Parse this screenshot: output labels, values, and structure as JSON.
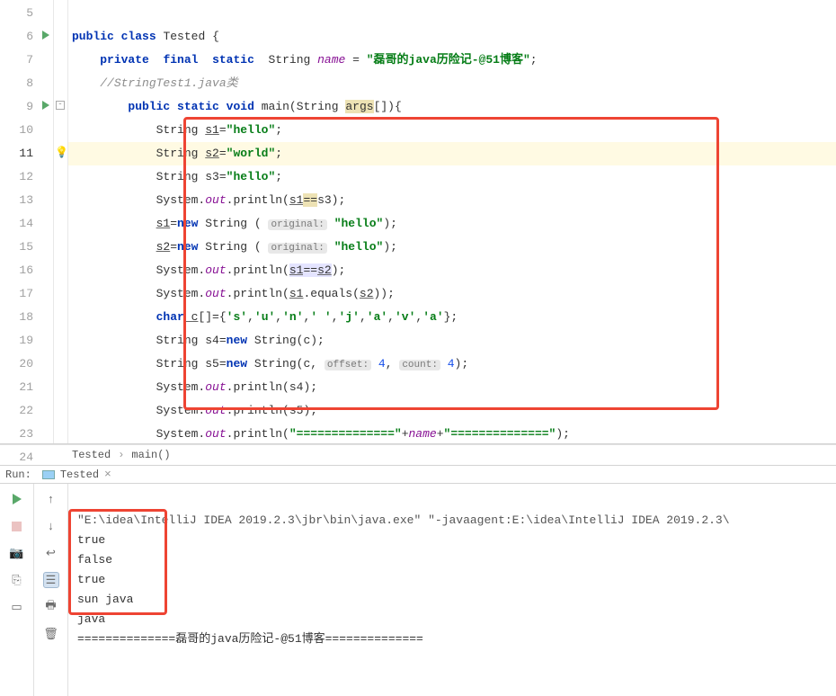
{
  "gutter": {
    "lines": [
      "5",
      "6",
      "7",
      "8",
      "9",
      "10",
      "11",
      "12",
      "13",
      "14",
      "15",
      "16",
      "17",
      "18",
      "19",
      "20",
      "21",
      "22",
      "23",
      "24"
    ]
  },
  "code": {
    "l6": {
      "public": "public",
      "class": "class",
      "name": "Tested"
    },
    "l7": {
      "private": "private",
      "final": "final",
      "static": "static",
      "type": "String",
      "field": "name",
      "eq": " = ",
      "str": "\"磊哥的java历险记-@51博客\""
    },
    "l8": {
      "comment": "//StringTest1.java类"
    },
    "l9": {
      "public": "public",
      "static": "static",
      "void": "void",
      "main": "main",
      "params": "(String ",
      "args": "args",
      "rest": "[]){"
    },
    "l10": {
      "type": "String ",
      "var": "s1",
      "eq": "=",
      "str": "\"hello\""
    },
    "l11": {
      "type": "String ",
      "var": "s2",
      "eq": "=",
      "str": "\"world\""
    },
    "l12": {
      "type": "String s3=",
      "str": "\"hello\""
    },
    "l13": {
      "sys": "System.",
      "out": "out",
      "print": ".println(",
      "s1": "s1",
      "op": "==",
      "rest": "s3);"
    },
    "l14": {
      "var": "s1",
      "eq": "=",
      "new": "new",
      "type": " String ( ",
      "hint": "original:",
      "str": " \"hello\"",
      "end": ");"
    },
    "l15": {
      "var": "s2",
      "eq": "=",
      "new": "new",
      "type": " String ( ",
      "hint": "original:",
      "str": " \"hello\"",
      "end": ");"
    },
    "l16": {
      "sys": "System.",
      "out": "out",
      "print": ".println(",
      "s1": "s1",
      "op": "==",
      "s2": "s2",
      "end": ");"
    },
    "l17": {
      "sys": "System.",
      "out": "out",
      "print": ".println(",
      "s1": "s1",
      "eq": ".equals(",
      "s2": "s2",
      "end": "));"
    },
    "l18": {
      "char": "char",
      "var": " c",
      "arr": "[]={",
      "c0": "'s'",
      "c1": "'u'",
      "c2": "'n'",
      "c3": "' '",
      "c4": "'j'",
      "c5": "'a'",
      "c6": "'v'",
      "c7": "'a'",
      "end": "};"
    },
    "l19": {
      "type": "String s4=",
      "new": "new",
      "rest": " String(c);"
    },
    "l20": {
      "type": "String s5=",
      "new": "new",
      "t2": " String(c, ",
      "h1": "offset:",
      "n1": " 4",
      "c": ", ",
      "h2": "count:",
      "n2": " 4",
      "end": ");"
    },
    "l21": {
      "sys": "System.",
      "out": "out",
      "print": ".println(s4);"
    },
    "l22": {
      "sys": "System.",
      "out": "out",
      "print": ".println(s5);"
    },
    "l23": {
      "sys": "System.",
      "out": "out",
      "p1": ".println(",
      "s1": "\"==============\"",
      "plus": "+",
      "name": "name",
      "plus2": "+",
      "s2": "\"==============\"",
      "end": ");"
    },
    "l24": {
      "brace": "}"
    }
  },
  "breadcrumb": {
    "class": "Tested",
    "method": "main()"
  },
  "run": {
    "label": "Run:",
    "tab": "Tested",
    "cmdline": "\"E:\\idea\\IntelliJ IDEA 2019.2.3\\jbr\\bin\\java.exe\" \"-javaagent:E:\\idea\\IntelliJ IDEA 2019.2.3\\",
    "out1": "true",
    "out2": "false",
    "out3": "true",
    "out4": "sun java",
    "out5": "java",
    "out6": "==============磊哥的java历险记-@51博客=============="
  }
}
